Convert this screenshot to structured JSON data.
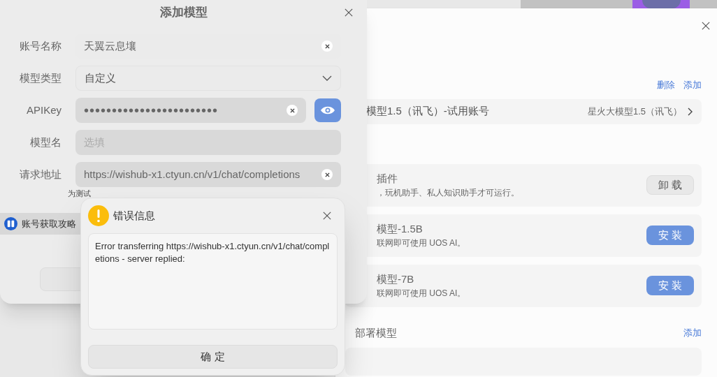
{
  "settings_window": {
    "account_actions": [
      "删除",
      "添加"
    ],
    "account_row": {
      "name": "模型1.5（讯飞）-试用账号",
      "model": "星火大模型1.5（讯飞）"
    },
    "cards": [
      {
        "title": "插件",
        "subtitle": "，玩机助手、私人知识助手才可运行。",
        "button": "卸 载",
        "kind": "installed"
      },
      {
        "title": "模型-1.5B",
        "subtitle": "联网即可使用 UOS AI。",
        "button": "安 装",
        "kind": "install"
      },
      {
        "title": "模型-7B",
        "subtitle": "联网即可使用 UOS AI。",
        "button": "安 装",
        "kind": "install"
      }
    ],
    "section": {
      "title": "部署模型",
      "action": "添加"
    }
  },
  "add_model_dialog": {
    "title": "添加模型",
    "fields": [
      {
        "label": "账号名称",
        "kind": "text",
        "value": "天翼云息壤"
      },
      {
        "label": "模型类型",
        "kind": "select",
        "value": "自定义"
      },
      {
        "label": "APIKey",
        "kind": "password",
        "value": "••••••••••••••••••••••••"
      },
      {
        "label": "模型名",
        "kind": "text",
        "placeholder": "选填"
      },
      {
        "label": "请求地址",
        "kind": "text",
        "value": "https://wishub-x1.ctyun.cn/v1/chat/completions"
      }
    ],
    "hint": "为测试",
    "guide_link": "账号获取攻略"
  },
  "error_dialog": {
    "title": "错误信息",
    "message": "Error transferring https://wishub-x1.ctyun.cn/v1/chat/completions - server replied:",
    "button": "确 定"
  }
}
